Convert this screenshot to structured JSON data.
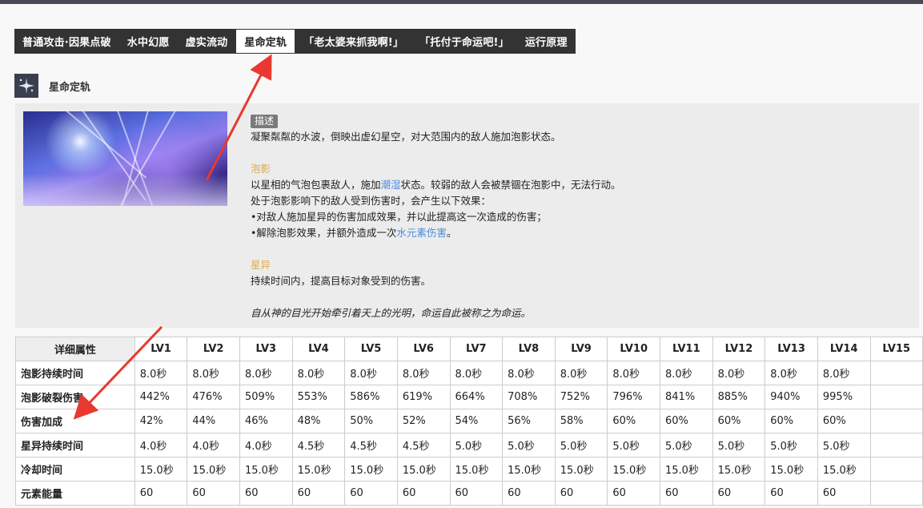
{
  "tabs": [
    {
      "label": "普通攻击·因果点破",
      "active": false
    },
    {
      "label": "水中幻愿",
      "active": false
    },
    {
      "label": "虚实流动",
      "active": false
    },
    {
      "label": "星命定轨",
      "active": true
    },
    {
      "label": "「老太婆来抓我啊!」",
      "active": false
    },
    {
      "label": "「托付于命运吧!」",
      "active": false
    },
    {
      "label": "运行原理",
      "active": false
    }
  ],
  "section": {
    "title": "星命定轨",
    "icon": "skill-icon"
  },
  "description": {
    "badge": "描述",
    "intro": "凝聚粼粼的水波，倒映出虚幻星空，对大范围内的敌人施加泡影状态。",
    "bubble_title": "泡影",
    "bubble_line1_a": "以星相的气泡包裹敌人，施加",
    "bubble_line1_link": "潮湿",
    "bubble_line1_b": "状态。较弱的敌人会被禁锢在泡影中，无法行动。",
    "bubble_line2": "处于泡影影响下的敌人受到伤害时，会产生以下效果：",
    "bubble_line3": "•对敌人施加星异的伤害加成效果，并以此提高这一次造成的伤害；",
    "bubble_line4_a": "•解除泡影效果，并额外造成一次",
    "bubble_line4_link": "水元素伤害",
    "bubble_line4_b": "。",
    "star_title": "星异",
    "star_line": "持续时间内，提高目标对象受到的伤害。",
    "quote": "自从神的目光开始牵引着天上的光明，命运自此被称之为命运。"
  },
  "table": {
    "header0": "详细属性",
    "levels": [
      "LV1",
      "LV2",
      "LV3",
      "LV4",
      "LV5",
      "LV6",
      "LV7",
      "LV8",
      "LV9",
      "LV10",
      "LV11",
      "LV12",
      "LV13",
      "LV14",
      "LV15"
    ],
    "rows": [
      {
        "name": "泡影持续时间",
        "values": [
          "8.0秒",
          "8.0秒",
          "8.0秒",
          "8.0秒",
          "8.0秒",
          "8.0秒",
          "8.0秒",
          "8.0秒",
          "8.0秒",
          "8.0秒",
          "8.0秒",
          "8.0秒",
          "8.0秒",
          "8.0秒",
          ""
        ]
      },
      {
        "name": "泡影破裂伤害",
        "values": [
          "442%",
          "476%",
          "509%",
          "553%",
          "586%",
          "619%",
          "664%",
          "708%",
          "752%",
          "796%",
          "841%",
          "885%",
          "940%",
          "995%",
          ""
        ]
      },
      {
        "name": "伤害加成",
        "values": [
          "42%",
          "44%",
          "46%",
          "48%",
          "50%",
          "52%",
          "54%",
          "56%",
          "58%",
          "60%",
          "60%",
          "60%",
          "60%",
          "60%",
          ""
        ]
      },
      {
        "name": "星异持续时间",
        "values": [
          "4.0秒",
          "4.0秒",
          "4.0秒",
          "4.5秒",
          "4.5秒",
          "4.5秒",
          "5.0秒",
          "5.0秒",
          "5.0秒",
          "5.0秒",
          "5.0秒",
          "5.0秒",
          "5.0秒",
          "5.0秒",
          ""
        ]
      },
      {
        "name": "冷却时间",
        "values": [
          "15.0秒",
          "15.0秒",
          "15.0秒",
          "15.0秒",
          "15.0秒",
          "15.0秒",
          "15.0秒",
          "15.0秒",
          "15.0秒",
          "15.0秒",
          "15.0秒",
          "15.0秒",
          "15.0秒",
          "15.0秒",
          ""
        ]
      },
      {
        "name": "元素能量",
        "values": [
          "60",
          "60",
          "60",
          "60",
          "60",
          "60",
          "60",
          "60",
          "60",
          "60",
          "60",
          "60",
          "60",
          "60",
          ""
        ]
      }
    ]
  },
  "colors": {
    "tab_bg": "#333333",
    "accent_gold": "#e0aa4a",
    "link_blue": "#4a8de0",
    "arrow_red": "#e8382f"
  }
}
